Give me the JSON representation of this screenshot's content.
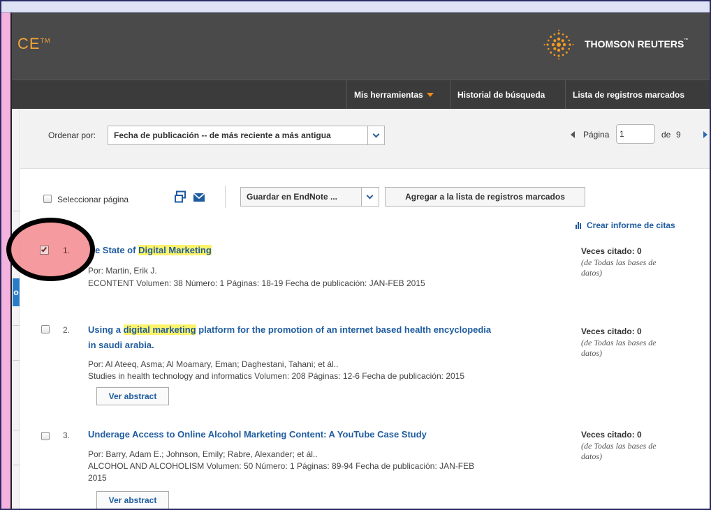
{
  "header": {
    "logo_fragment": "CE",
    "logo_tm": "TM",
    "brand": "THOMSON REUTERS",
    "brand_tm": "™"
  },
  "nav": {
    "tools": "Mis herramientas",
    "history": "Historial de búsqueda",
    "marked": "Lista de registros marcados"
  },
  "sort": {
    "label": "Ordenar por:",
    "selected": "Fecha de publicación -- de más reciente a más antigua"
  },
  "pagination": {
    "label": "Página",
    "current": "1",
    "of": "de",
    "total": "9"
  },
  "actions": {
    "select_page": "Seleccionar página",
    "save_to": "Guardar en EndNote ...",
    "add_marked": "Agregar a la lista de registros marcados",
    "citation_report": "Crear informe de citas"
  },
  "left_panel": {
    "blue_tab": "o"
  },
  "records": [
    {
      "num": "1.",
      "checked": true,
      "title_pre": "he State of ",
      "title_hl": "Digital Marketing",
      "title_post": "",
      "authors": "Por: Martin, Erik J.",
      "source": "ECONTENT  Volumen: 38   Número: 1   Páginas: 18-19   Fecha de publicación: JAN-FEB 2015",
      "cited": "Veces citado: 0",
      "cited_sub_1": "(de Todas las bases de",
      "cited_sub_2": "datos)"
    },
    {
      "num": "2.",
      "checked": false,
      "title_pre": "Using a ",
      "title_hl": "digital marketing",
      "title_post": " platform for the promotion of an internet based health encyclopedia",
      "title_line2": "in saudi arabia.",
      "authors": "Por: Al Ateeq, Asma; Al Moamary, Eman; Daghestani, Tahani; et ál..",
      "source": "Studies in health technology and informatics  Volumen: 208   Páginas: 12-6   Fecha de publicación: 2015",
      "button": "Ver abstract",
      "cited": "Veces citado: 0",
      "cited_sub_1": "(de Todas las bases de",
      "cited_sub_2": "datos)"
    },
    {
      "num": "3.",
      "checked": false,
      "title": "Underage Access to Online Alcohol Marketing Content: A YouTube Case Study",
      "authors": "Por: Barry, Adam E.; Johnson, Emily; Rabre, Alexander; et ál..",
      "source": "ALCOHOL AND ALCOHOLISM  Volumen: 50   Número: 1   Páginas: 89-94   Fecha de publicación: JAN-FEB",
      "source_line2": "2015",
      "button": "Ver abstract",
      "cited": "Veces citado: 0",
      "cited_sub_1": "(de Todas las bases de",
      "cited_sub_2": "datos)"
    }
  ],
  "colors": {
    "header_bg": "#4a4a4a",
    "nav_bg": "#3b3b3b",
    "accent_orange": "#f08a1c",
    "link_blue": "#1f5c9f",
    "highlight_yellow": "#fcf36a",
    "annotation_fill": "#f48c92",
    "pink_panel": "#f4b3df"
  }
}
